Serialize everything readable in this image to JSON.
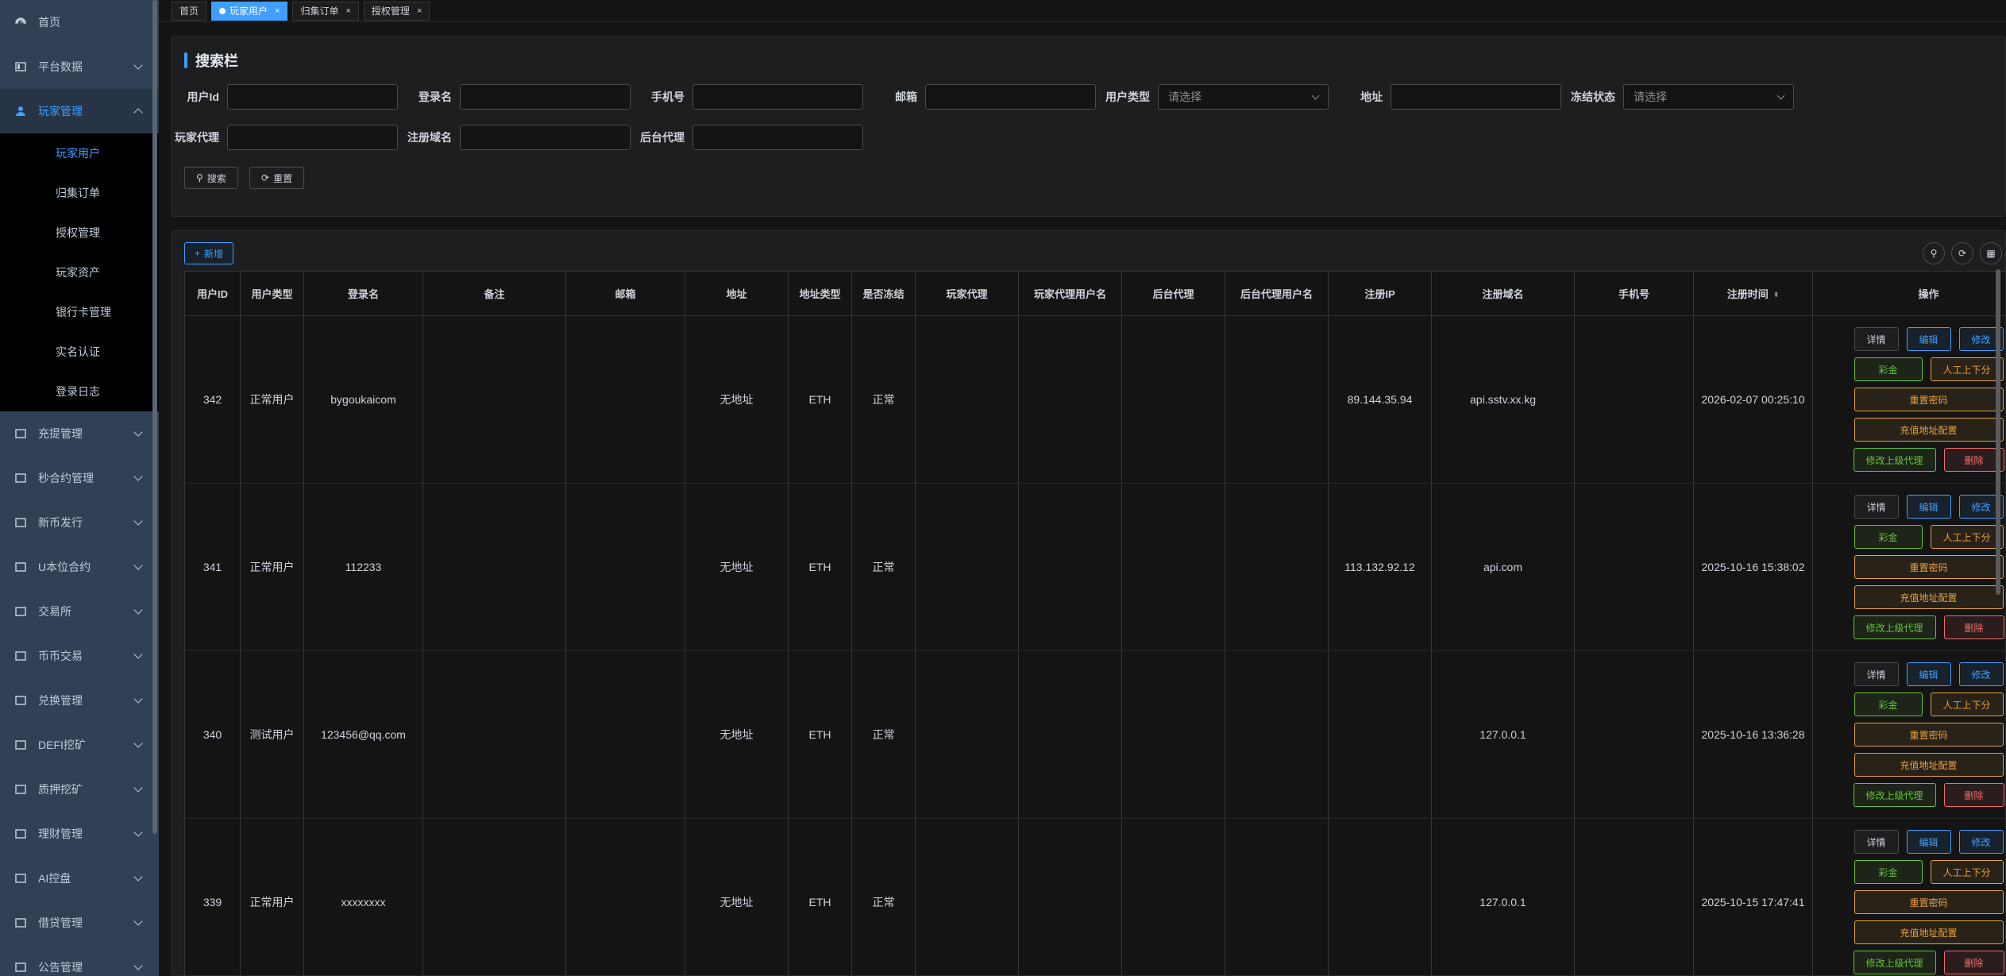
{
  "sidebar": {
    "home": "首页",
    "platform_data": "平台数据",
    "player_mgmt": "玩家管理",
    "sub_items": [
      "玩家用户",
      "归集订单",
      "授权管理",
      "玩家资产",
      "银行卡管理",
      "实名认证",
      "登录日志"
    ],
    "items_after": [
      "充提管理",
      "秒合约管理",
      "新币发行",
      "U本位合约",
      "交易所",
      "币币交易",
      "兑换管理",
      "DEFI挖矿",
      "质押挖矿",
      "理财管理",
      "AI控盘",
      "借贷管理",
      "公告管理"
    ]
  },
  "tabs": [
    {
      "label": "首页"
    },
    {
      "label": "玩家用户"
    },
    {
      "label": "归集订单"
    },
    {
      "label": "授权管理"
    }
  ],
  "search": {
    "title": "搜索栏",
    "fields": {
      "user_id": "用户Id",
      "login_name": "登录名",
      "phone": "手机号",
      "email": "邮箱",
      "user_type": "用户类型",
      "address": "地址",
      "freeze_status": "冻结状态",
      "player_agent": "玩家代理",
      "reg_domain": "注册域名",
      "backend_agent": "后台代理"
    },
    "select_placeholder": "请选择",
    "search_btn": "搜索",
    "reset_btn": "重置"
  },
  "table": {
    "add_btn": "新增",
    "columns": [
      "用户ID",
      "用户类型",
      "登录名",
      "备注",
      "邮箱",
      "地址",
      "地址类型",
      "是否冻结",
      "玩家代理",
      "玩家代理用户名",
      "后台代理",
      "后台代理用户名",
      "注册IP",
      "注册域名",
      "手机号",
      "注册时间",
      "操作"
    ],
    "rows": [
      {
        "id": "342",
        "type": "正常用户",
        "login": "bygoukaicom",
        "remark": "",
        "email": "",
        "address": "无地址",
        "addr_type": "ETH",
        "frozen": "正常",
        "pagent": "",
        "pagent_name": "",
        "bagent": "",
        "bagent_name": "",
        "ip": "89.144.35.94",
        "domain": "api.sstv.xx.kg",
        "phone": "",
        "time": "2026-02-07 00:25:10"
      },
      {
        "id": "341",
        "type": "正常用户",
        "login": "112233",
        "remark": "",
        "email": "",
        "address": "无地址",
        "addr_type": "ETH",
        "frozen": "正常",
        "pagent": "",
        "pagent_name": "",
        "bagent": "",
        "bagent_name": "",
        "ip": "113.132.92.12",
        "domain": "api.com",
        "phone": "",
        "time": "2025-10-16 15:38:02"
      },
      {
        "id": "340",
        "type": "测试用户",
        "login": "123456@qq.com",
        "remark": "",
        "email": "",
        "address": "无地址",
        "addr_type": "ETH",
        "frozen": "正常",
        "pagent": "",
        "pagent_name": "",
        "bagent": "",
        "bagent_name": "",
        "ip": "",
        "domain": "127.0.0.1",
        "phone": "",
        "time": "2025-10-16 13:36:28"
      },
      {
        "id": "339",
        "type": "正常用户",
        "login": "xxxxxxxx",
        "remark": "",
        "email": "",
        "address": "无地址",
        "addr_type": "ETH",
        "frozen": "正常",
        "pagent": "",
        "pagent_name": "",
        "bagent": "",
        "bagent_name": "",
        "ip": "",
        "domain": "127.0.0.1",
        "phone": "",
        "time": "2025-10-15 17:47:41"
      }
    ],
    "ops": {
      "detail": "详情",
      "edit1": "编辑",
      "edit2": "修改",
      "lottery": "彩金",
      "manual": "人工上下分",
      "reset_pwd": "重置密码",
      "recharge_cfg": "充值地址配置",
      "change_agent": "修改上级代理",
      "delete": "删除"
    }
  },
  "colors": {
    "accent": "#409eff",
    "sidebar_bg": "#304156",
    "green": "#67c23a",
    "orange": "#e6a23c",
    "red": "#f56c6c"
  }
}
